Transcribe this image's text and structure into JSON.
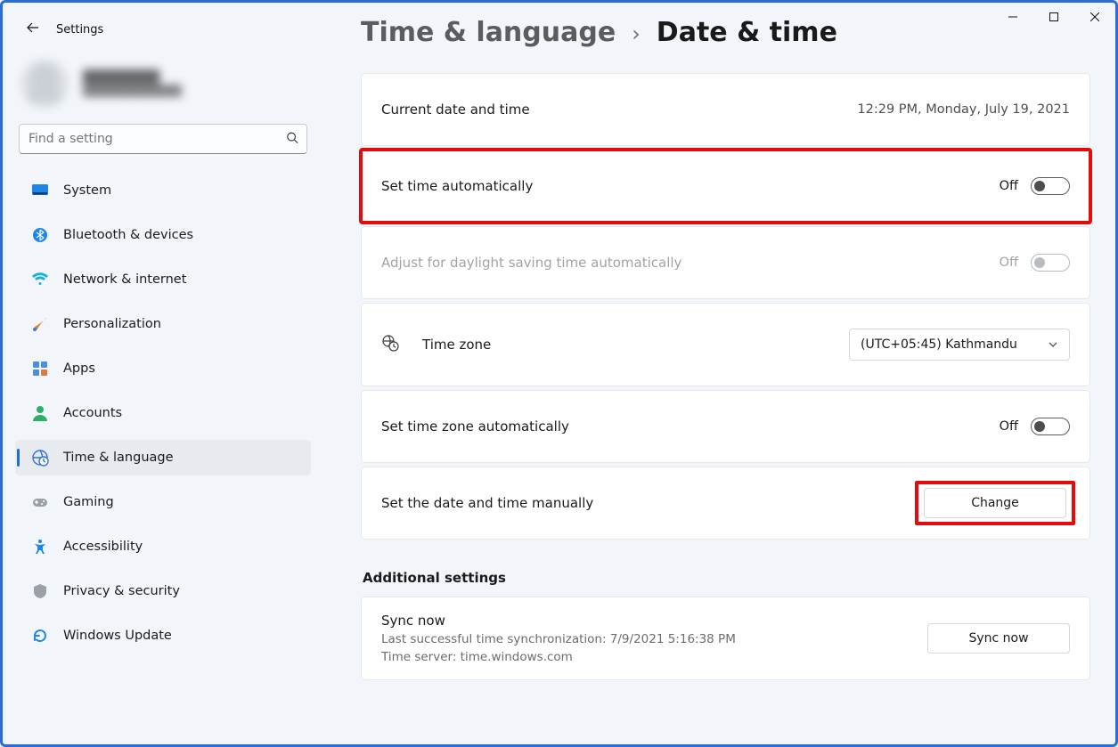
{
  "app": {
    "name": "Settings"
  },
  "search": {
    "placeholder": "Find a setting"
  },
  "sidebar": {
    "items": [
      {
        "label": "System"
      },
      {
        "label": "Bluetooth & devices"
      },
      {
        "label": "Network & internet"
      },
      {
        "label": "Personalization"
      },
      {
        "label": "Apps"
      },
      {
        "label": "Accounts"
      },
      {
        "label": "Time & language"
      },
      {
        "label": "Gaming"
      },
      {
        "label": "Accessibility"
      },
      {
        "label": "Privacy & security"
      },
      {
        "label": "Windows Update"
      }
    ]
  },
  "breadcrumb": {
    "parent": "Time & language",
    "sep": "›",
    "current": "Date & time"
  },
  "rows": {
    "current": {
      "label": "Current date and time",
      "value": "12:29 PM, Monday, July 19, 2021"
    },
    "set_auto": {
      "label": "Set time automatically",
      "state": "Off"
    },
    "dst": {
      "label": "Adjust for daylight saving time automatically",
      "state": "Off"
    },
    "tz": {
      "label": "Time zone",
      "selected": "(UTC+05:45) Kathmandu"
    },
    "tz_auto": {
      "label": "Set time zone automatically",
      "state": "Off"
    },
    "manual": {
      "label": "Set the date and time manually",
      "button": "Change"
    }
  },
  "additional": {
    "heading": "Additional settings",
    "sync": {
      "title": "Sync now",
      "last": "Last successful time synchronization: 7/9/2021 5:16:38 PM",
      "server": "Time server: time.windows.com",
      "button": "Sync now"
    }
  }
}
